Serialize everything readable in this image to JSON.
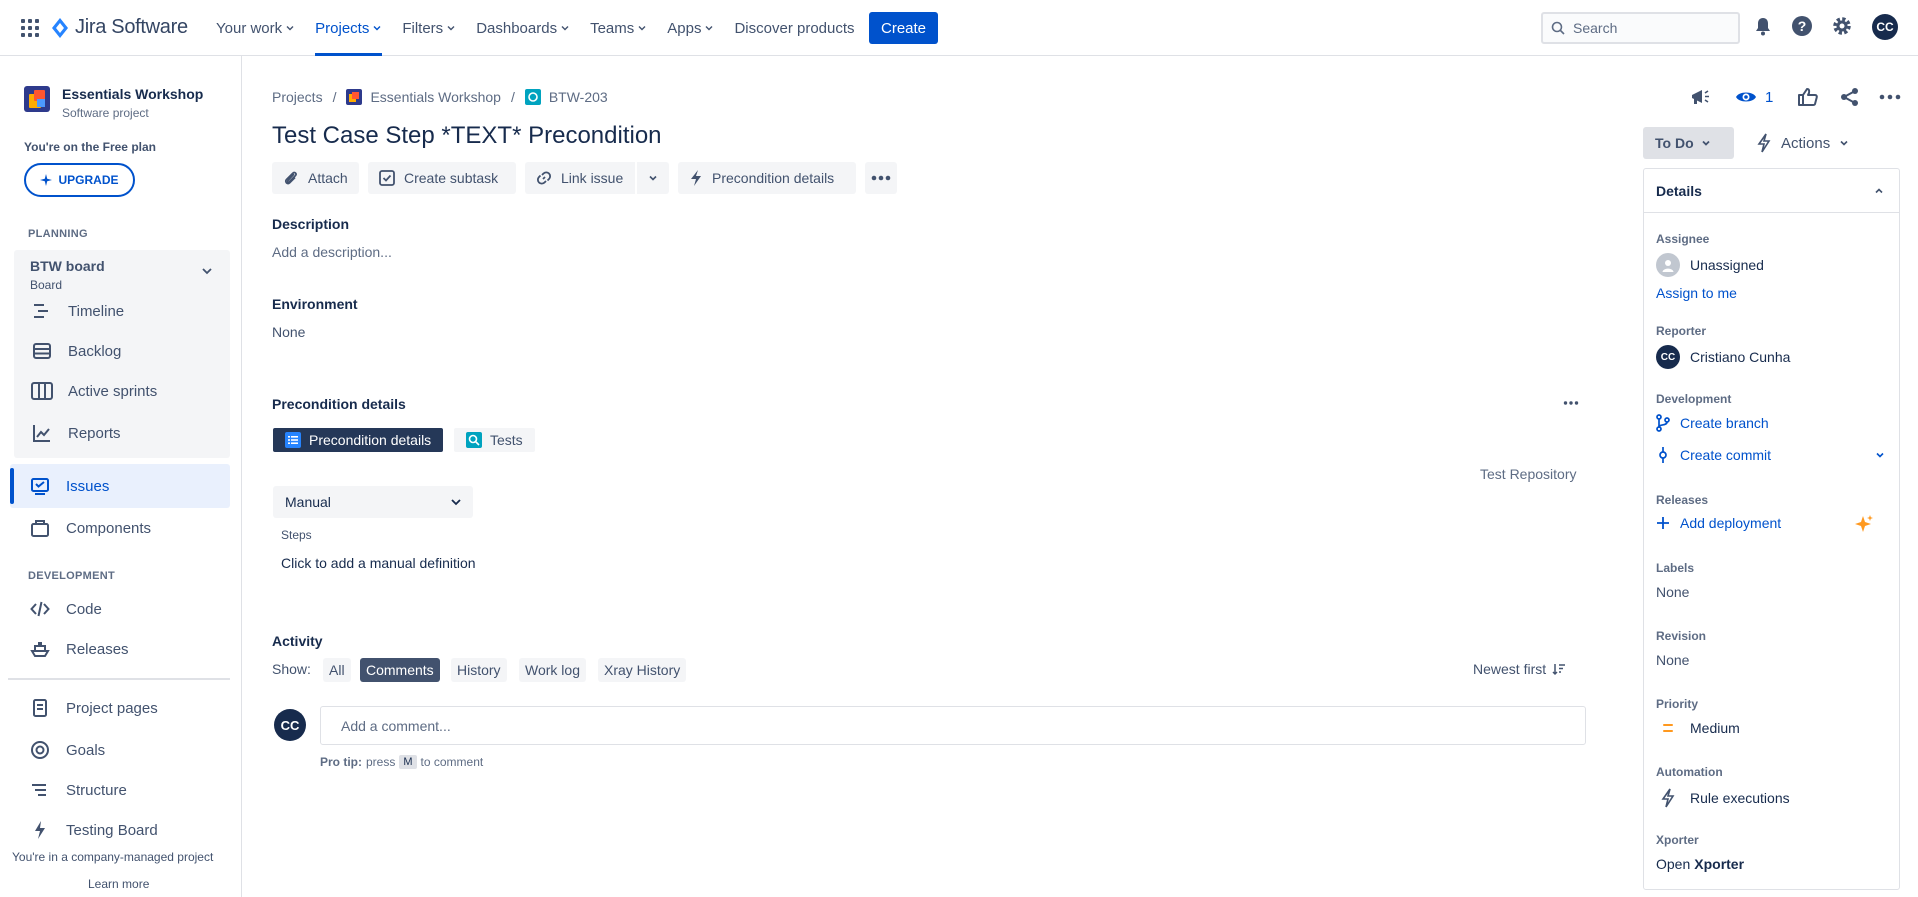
{
  "topnav": {
    "product": "Jira Software",
    "menu": [
      "Your work",
      "Projects",
      "Filters",
      "Dashboards",
      "Teams",
      "Apps"
    ],
    "discover": "Discover products",
    "create": "Create",
    "search_placeholder": "Search",
    "avatar": "CC"
  },
  "sidebar": {
    "project_name": "Essentials Workshop",
    "project_type": "Software project",
    "plan": "You're on the Free plan",
    "upgrade": "UPGRADE",
    "planning_header": "PLANNING",
    "board_name": "BTW board",
    "board_type": "Board",
    "planning_items": [
      "Timeline",
      "Backlog",
      "Active sprints",
      "Reports"
    ],
    "issues": "Issues",
    "components": "Components",
    "development_header": "DEVELOPMENT",
    "dev_items": [
      "Code",
      "Releases"
    ],
    "extra_items": [
      "Project pages",
      "Goals",
      "Structure",
      "Testing Board"
    ],
    "company": "You're in a company-managed project",
    "learn_more": "Learn more"
  },
  "breadcrumbs": {
    "projects": "Projects",
    "project": "Essentials Workshop",
    "issue_key": "BTW-203"
  },
  "issue": {
    "title": "Test Case Step *TEXT* Precondition",
    "watch_count": "1"
  },
  "toolbar": {
    "attach": "Attach",
    "create_subtask": "Create subtask",
    "link_issue": "Link issue",
    "precondition_details": "Precondition details"
  },
  "description": {
    "label": "Description",
    "placeholder": "Add a description..."
  },
  "environment": {
    "label": "Environment",
    "value": "None"
  },
  "precondition": {
    "label": "Precondition details",
    "tab_details": "Precondition details",
    "tab_tests": "Tests",
    "test_repository": "Test Repository",
    "type_value": "Manual",
    "steps_label": "Steps",
    "steps_placeholder": "Click to add a manual definition"
  },
  "activity": {
    "label": "Activity",
    "show": "Show:",
    "filters": [
      "All",
      "Comments",
      "History",
      "Work log",
      "Xray History"
    ],
    "sort": "Newest first",
    "comment_placeholder": "Add a comment...",
    "protip_bold": "Pro tip:",
    "protip_press": "press",
    "protip_key": "M",
    "protip_rest": "to comment",
    "avatar": "CC"
  },
  "status": {
    "value": "To Do",
    "actions": "Actions"
  },
  "details": {
    "header": "Details",
    "assignee_label": "Assignee",
    "assignee_value": "Unassigned",
    "assign_to_me": "Assign to me",
    "reporter_label": "Reporter",
    "reporter_value": "Cristiano Cunha",
    "reporter_avatar": "CC",
    "development_label": "Development",
    "create_branch": "Create branch",
    "create_commit": "Create commit",
    "releases_label": "Releases",
    "add_deployment": "Add deployment",
    "labels_label": "Labels",
    "labels_value": "None",
    "revision_label": "Revision",
    "revision_value": "None",
    "priority_label": "Priority",
    "priority_value": "Medium",
    "automation_label": "Automation",
    "automation_value": "Rule executions",
    "xporter_label": "Xporter",
    "xporter_open": "Open",
    "xporter_name": "Xporter"
  },
  "colors": {
    "primary": "#0052cc",
    "text": "#172b4d",
    "muted": "#5e6c84",
    "selected_bg": "#e9f0fd",
    "priority_medium": "#ff991f"
  }
}
